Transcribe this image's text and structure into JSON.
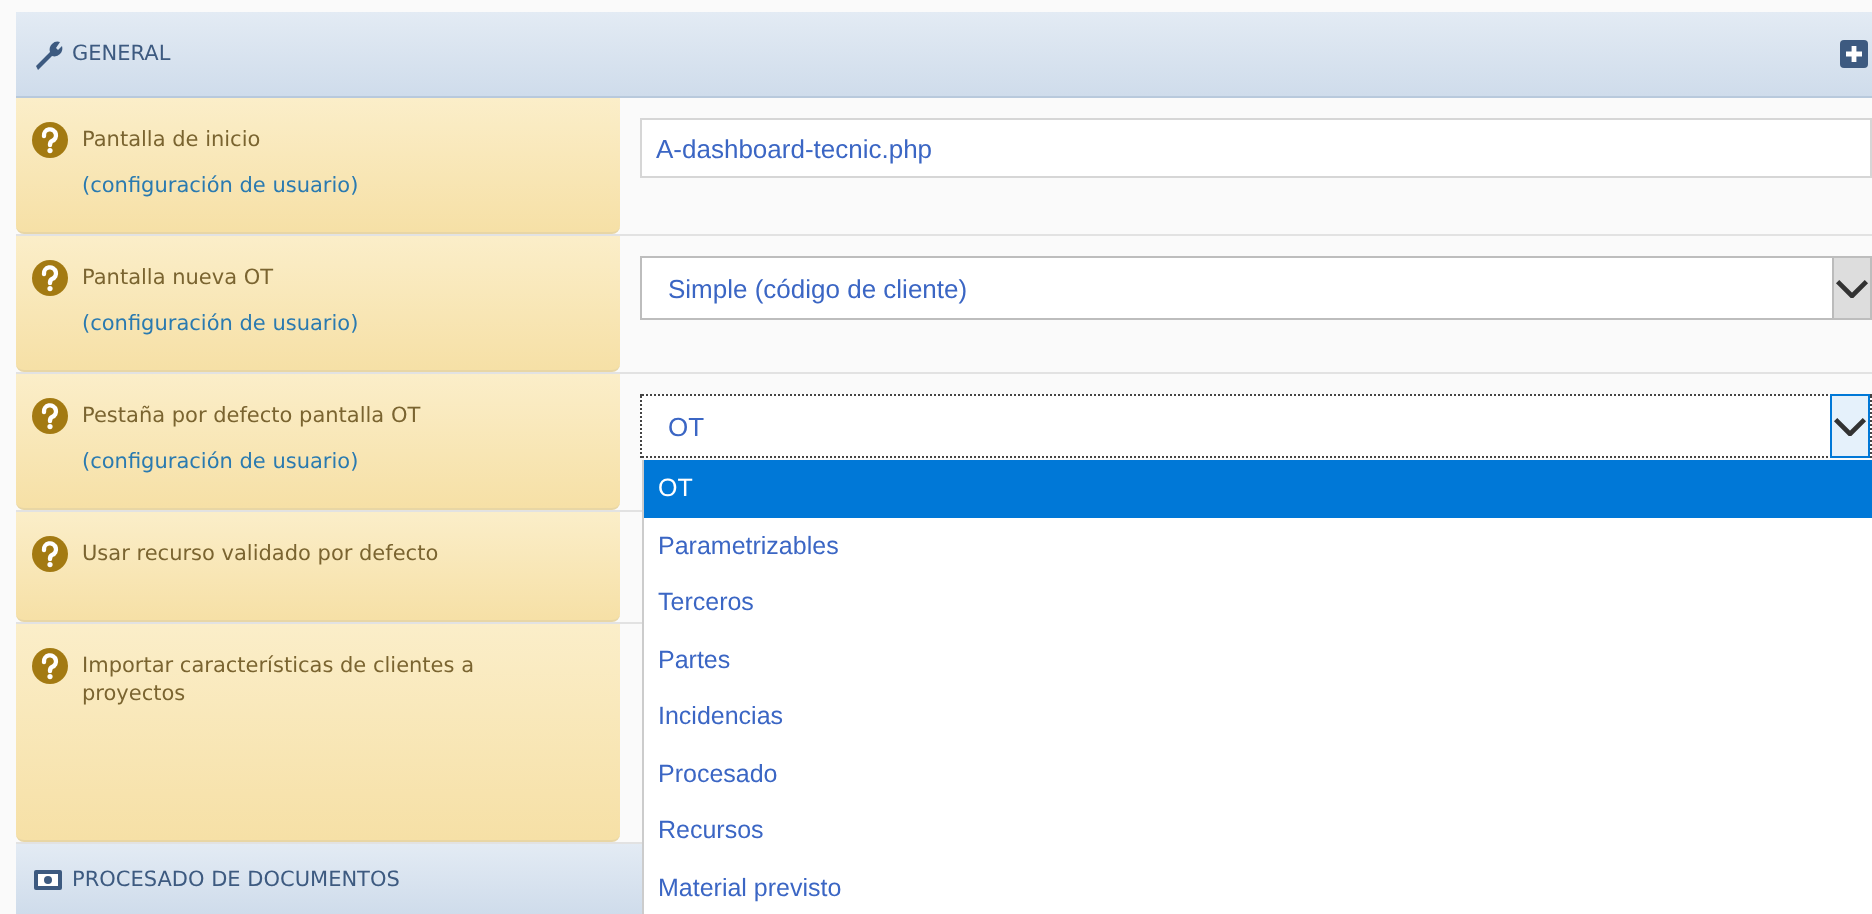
{
  "sections": [
    {
      "title": "GENERAL",
      "rows": [
        {
          "label": "Pantalla de inicio",
          "note": "(configuración de usuario)",
          "control": {
            "kind": "text",
            "value": "A-dashboard-tecnic.php"
          }
        },
        {
          "label": "Pantalla nueva OT",
          "note": "(configuración de usuario)",
          "control": {
            "kind": "select",
            "value": "Simple (código de cliente)",
            "open": false
          }
        },
        {
          "label": "Pestaña por defecto pantalla OT",
          "note": "(configuración de usuario)",
          "control": {
            "kind": "select",
            "value": "OT",
            "open": true,
            "options": [
              {
                "label": "OT",
                "selected": true
              },
              {
                "label": "Parametrizables",
                "selected": false
              },
              {
                "label": "Terceros",
                "selected": false
              },
              {
                "label": "Partes",
                "selected": false
              },
              {
                "label": "Incidencias",
                "selected": false
              },
              {
                "label": "Procesado",
                "selected": false
              },
              {
                "label": "Recursos",
                "selected": false
              },
              {
                "label": "Material previsto",
                "selected": false
              }
            ]
          }
        },
        {
          "label": "Usar recurso validado por defecto"
        },
        {
          "label": "Importar características de clientes a proyectos"
        }
      ]
    },
    {
      "title": "PROCESADO DE DOCUMENTOS"
    }
  ]
}
